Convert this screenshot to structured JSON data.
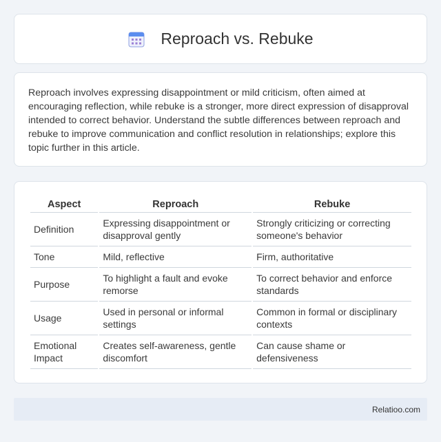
{
  "header": {
    "title": "Reproach vs. Rebuke",
    "icon": "calendar-grid-icon"
  },
  "intro": {
    "text": "Reproach involves expressing disappointment or mild criticism, often aimed at encouraging reflection, while rebuke is a stronger, more direct expression of disapproval intended to correct behavior. Understand the subtle differences between reproach and rebuke to improve communication and conflict resolution in relationships; explore this topic further in this article."
  },
  "table": {
    "headers": [
      "Aspect",
      "Reproach",
      "Rebuke"
    ],
    "rows": [
      [
        "Definition",
        "Expressing disappointment or disapproval gently",
        "Strongly criticizing or correcting someone's behavior"
      ],
      [
        "Tone",
        "Mild, reflective",
        "Firm, authoritative"
      ],
      [
        "Purpose",
        "To highlight a fault and evoke remorse",
        "To correct behavior and enforce standards"
      ],
      [
        "Usage",
        "Used in personal or informal settings",
        "Common in formal or disciplinary contexts"
      ],
      [
        "Emotional Impact",
        "Creates self-awareness, gentle discomfort",
        "Can cause shame or defensiveness"
      ]
    ]
  },
  "footer": {
    "brand": "Relatioo.com"
  }
}
